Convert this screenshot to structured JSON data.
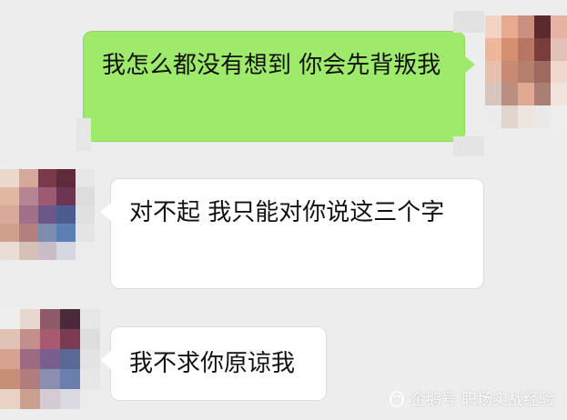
{
  "messages": [
    {
      "sender": "self",
      "text": "我怎么都没有想到 你会先背叛我"
    },
    {
      "sender": "other",
      "text": "对不起 我只能对你说这三个字"
    },
    {
      "sender": "other",
      "text": "我不求你原谅我"
    }
  ],
  "watermark": {
    "text": "企鹅号 职场实战经验",
    "icon": "penguin-icon"
  },
  "colors": {
    "background": "#ededed",
    "sent_bubble": "#9eea6a",
    "received_bubble": "#ffffff",
    "text": "#111111"
  }
}
